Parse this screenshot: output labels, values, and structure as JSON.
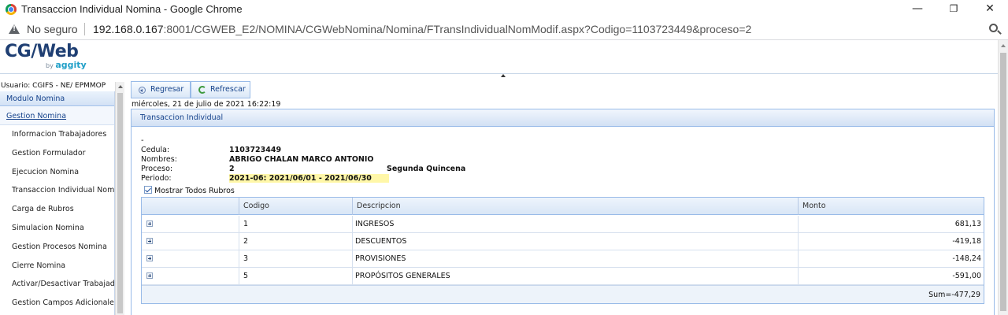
{
  "browser": {
    "window_title": "Transaccion Individual Nomina - Google Chrome",
    "security_label": "No seguro",
    "url_host": "192.168.0.167",
    "url_path": ":8001/CGWEB_E2/NOMINA/CGWebNomina/Nomina/FTransIndividualNomModif.aspx?Codigo=1103723449&proceso=2",
    "minimize_glyph": "—",
    "restore_glyph": "❐",
    "close_glyph": "✕"
  },
  "logo": {
    "main": "CG/Web",
    "by": "by",
    "brand": "aggity"
  },
  "sidebar": {
    "user_label": "Usuario: CGIFS - NE/ EPMMOP",
    "header": "Modulo Nomina",
    "group": "Gestion Nomina",
    "items": [
      "Informacion Trabajadores",
      "Gestion Formulador",
      "Ejecucion Nomina",
      "Transaccion Individual Nomina",
      "Carga de Rubros",
      "Simulacion Nomina",
      "Gestion Procesos Nomina",
      "Cierre Nomina",
      "Activar/Desactivar Trabajadores",
      "Gestion Campos Adicionales"
    ]
  },
  "toolbar": {
    "back_label": "Regresar",
    "refresh_label": "Refrescar"
  },
  "date_line": "miércoles, 21 de julio de 2021 16:22:19",
  "panel": {
    "title": "Transaccion Individual",
    "dash": "-",
    "cedula_label": "Cedula:",
    "cedula_value": "1103723449",
    "nombres_label": "Nombres:",
    "nombres_value": "ABRIGO CHALAN MARCO ANTONIO",
    "proceso_label": "Proceso:",
    "proceso_value": "2",
    "proceso_desc": "Segunda Quincena",
    "periodo_label": "Periodo:",
    "periodo_value": "2021-06: 2021/06/01 - 2021/06/30",
    "checkbox_label": "Mostrar Todos Rubros",
    "checkbox_checked": true
  },
  "grid": {
    "columns": [
      "",
      "Codigo",
      "Descripcion",
      "Monto"
    ],
    "rows": [
      {
        "codigo": "1",
        "descripcion": "INGRESOS",
        "monto": "681,13"
      },
      {
        "codigo": "2",
        "descripcion": "DESCUENTOS",
        "monto": "-419,18"
      },
      {
        "codigo": "3",
        "descripcion": "PROVISIONES",
        "monto": "-148,24"
      },
      {
        "codigo": "5",
        "descripcion": "PROPÓSITOS GENERALES",
        "monto": "-591,00"
      }
    ],
    "sum": "Sum=-477,29"
  }
}
